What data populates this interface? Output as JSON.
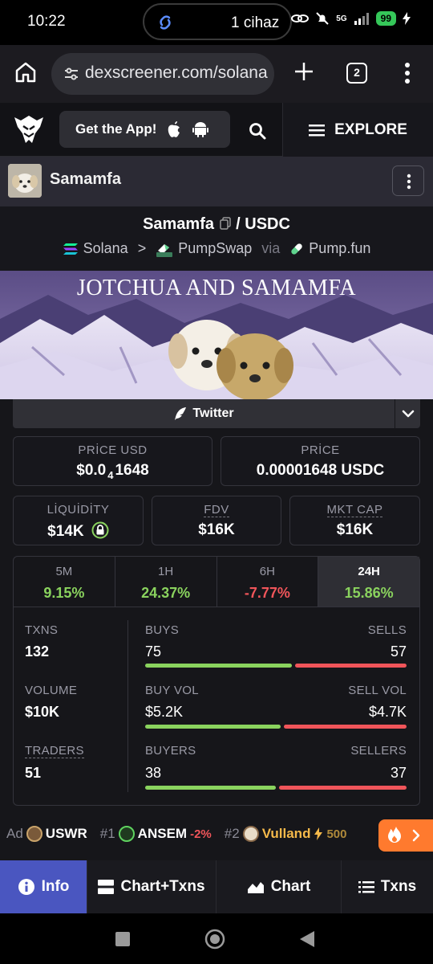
{
  "status_bar": {
    "time": "10:22",
    "pill_text": "1 cihaz",
    "network": "5G",
    "battery": "99"
  },
  "browser": {
    "url": "dexscreener.com/solana",
    "tab_count": "2"
  },
  "header": {
    "get_app_label": "Get the App!",
    "explore_label": "EXPLORE"
  },
  "token": {
    "name": "Samamfa"
  },
  "pair": {
    "base": "Samamfa",
    "separator": "/",
    "quote": "USDC",
    "chain": "Solana",
    "arrow": ">",
    "dex": "PumpSwap",
    "via": "via",
    "launchpad": "Pump.fun"
  },
  "banner": {
    "title": "JOTCHUA AND SAMAMFA"
  },
  "socials": {
    "twitter_label": "Twitter"
  },
  "prices": {
    "price_usd_label": "PRİCE USD",
    "price_usd_prefix": "$0.0",
    "price_usd_zeros": "4",
    "price_usd_digits": "1648",
    "price_label": "PRİCE",
    "price_value": "0.00001648 USDC"
  },
  "metrics": {
    "liquidity_label": "LİQUİDİTY",
    "liquidity_value": "$14K",
    "fdv_label": "FDV",
    "fdv_value": "$16K",
    "mktcap_label": "MKT CAP",
    "mktcap_value": "$16K"
  },
  "timeframes": [
    {
      "label": "5M",
      "value": "9.15%"
    },
    {
      "label": "1H",
      "value": "24.37%"
    },
    {
      "label": "6H",
      "value": "-7.77%"
    },
    {
      "label": "24H",
      "value": "15.86%"
    }
  ],
  "stats": {
    "txns_label": "TXNS",
    "txns_value": "132",
    "buys_label": "BUYS",
    "buys_value": "75",
    "sells_label": "SELLS",
    "sells_value": "57",
    "buys_ratio": 0.568,
    "volume_label": "VOLUME",
    "volume_value": "$10K",
    "buy_vol_label": "BUY VOL",
    "buy_vol_value": "$5.2K",
    "sell_vol_label": "SELL VOL",
    "sell_vol_value": "$4.7K",
    "buy_vol_ratio": 0.525,
    "traders_label": "TRADERS",
    "traders_value": "51",
    "buyers_label": "BUYERS",
    "buyers_value": "38",
    "sellers_label": "SELLERS",
    "sellers_value": "37",
    "buyers_ratio": 0.507
  },
  "ticker": {
    "ad_label": "Ad",
    "ad_symbol": "USWR",
    "item1_rank": "#1",
    "item1_symbol": "ANSEM",
    "item1_change": "-2%",
    "item2_rank": "#2",
    "item2_symbol": "Vulland",
    "item2_boost": "500"
  },
  "bottom_nav": {
    "info": "Info",
    "chart_txns": "Chart+Txns",
    "chart": "Chart",
    "txns": "Txns"
  },
  "colors": {
    "green": "#8ad35e",
    "red": "#f0555a",
    "active_nav": "#4a56c0",
    "accent_orange": "#ff7a2e"
  }
}
